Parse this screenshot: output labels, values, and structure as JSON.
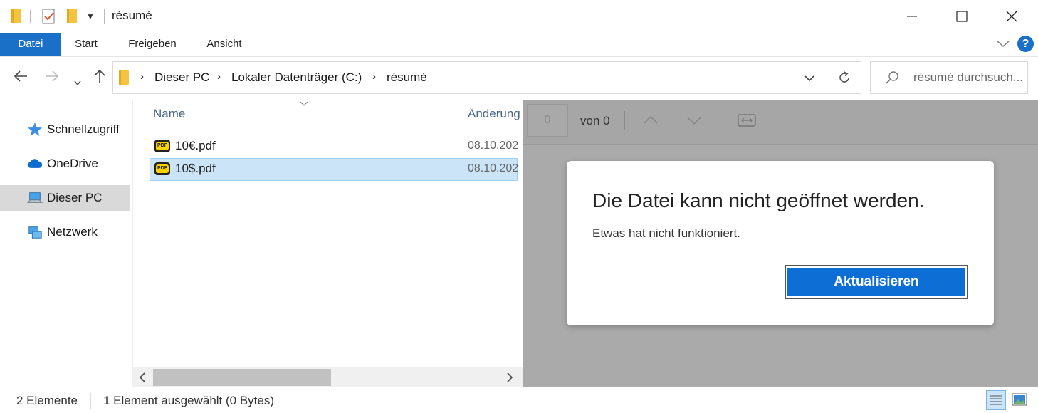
{
  "window": {
    "title": "résumé",
    "minimize": "—",
    "maximize": "☐",
    "close": "✕"
  },
  "ribbon": {
    "tabs": [
      "Datei",
      "Start",
      "Freigeben",
      "Ansicht"
    ],
    "active_tab": "Datei",
    "help": "?"
  },
  "address": {
    "crumbs": [
      "Dieser PC",
      "Lokaler Datenträger (C:)",
      "résumé"
    ],
    "search_placeholder": "résumé durchsuch..."
  },
  "nav": {
    "items": [
      {
        "label": "Schnellzugriff",
        "icon": "star-icon"
      },
      {
        "label": "OneDrive",
        "icon": "cloud-icon"
      },
      {
        "label": "Dieser PC",
        "icon": "computer-icon",
        "selected": true
      },
      {
        "label": "Netzwerk",
        "icon": "network-icon"
      }
    ]
  },
  "filelist": {
    "columns": [
      "Name",
      "Änderung"
    ],
    "files": [
      {
        "name": "10€.pdf",
        "date": "08.10.202",
        "selected": false
      },
      {
        "name": "10$.pdf",
        "date": "08.10.202",
        "selected": true
      }
    ]
  },
  "preview": {
    "page_input": "0",
    "page_of": "von 0",
    "dialog": {
      "title": "Die Datei kann nicht geöffnet werden.",
      "message": "Etwas hat nicht funktioniert.",
      "button": "Aktualisieren"
    }
  },
  "status": {
    "count": "2 Elemente",
    "selection": "1 Element ausgewählt (0 Bytes)"
  },
  "colors": {
    "accent": "#1a6fc6",
    "button": "#0d6fd6",
    "selection": "#cce4f7",
    "preview_bg": "#aaaaaa"
  }
}
